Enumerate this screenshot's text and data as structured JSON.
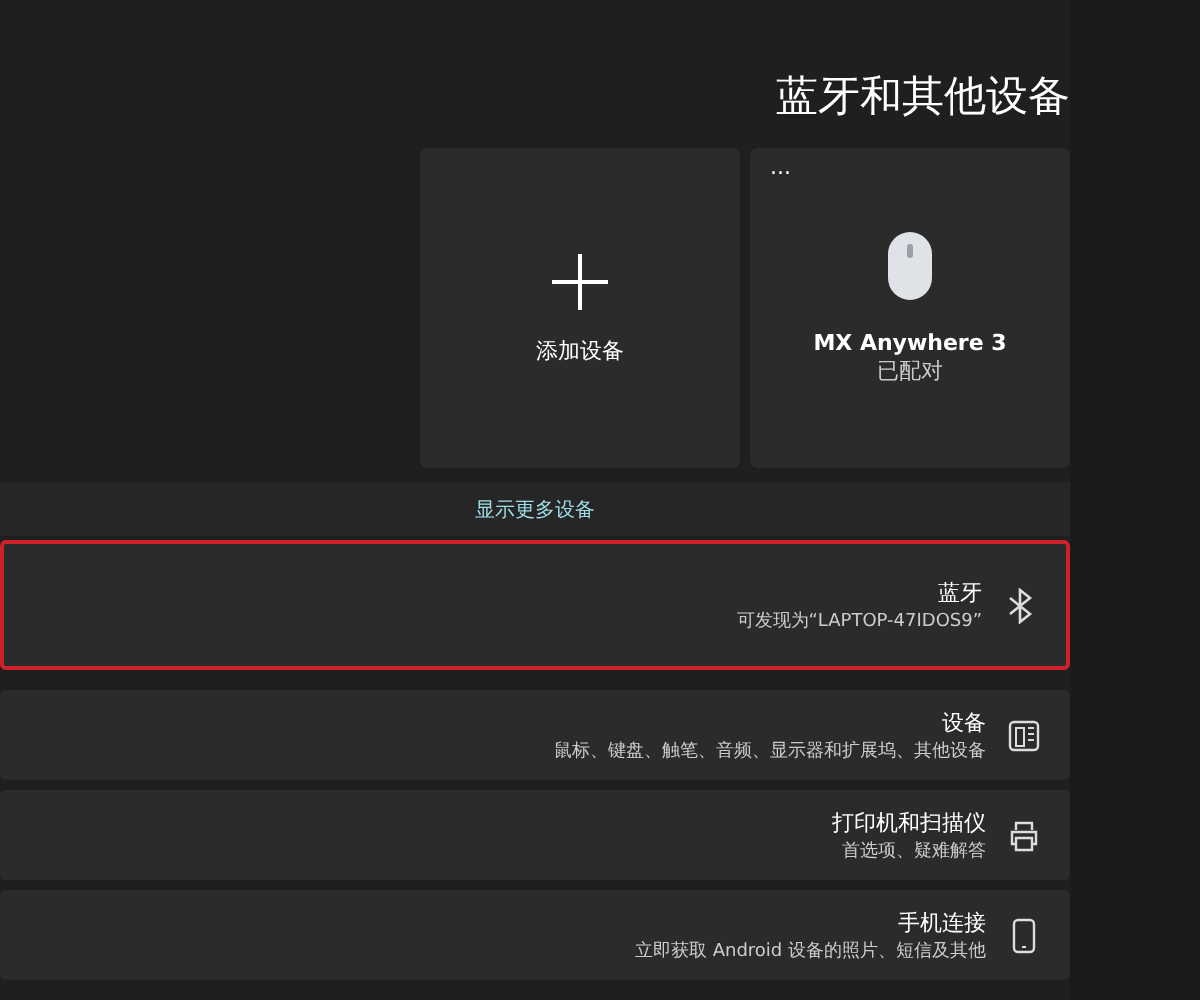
{
  "title": "蓝牙和其他设备",
  "cards": [
    {
      "kind": "add",
      "label": "添加设备"
    },
    {
      "kind": "device",
      "menu": "...",
      "name": "MX Anywhere 3",
      "status": "已配对"
    }
  ],
  "show_more": "显示更多设备",
  "rows": [
    {
      "kind": "bluetooth",
      "title": "蓝牙",
      "subtitle": "可发现为“LAPTOP-47IDOS9”",
      "highlighted": true
    },
    {
      "kind": "devices",
      "title": "设备",
      "subtitle": "鼠标、键盘、触笔、音频、显示器和扩展坞、其他设备",
      "highlighted": false
    },
    {
      "kind": "printer",
      "title": "打印机和扫描仪",
      "subtitle": "首选项、疑难解答",
      "highlighted": false
    },
    {
      "kind": "phone",
      "title": "手机连接",
      "subtitle": "立即获取 Android 设备的照片、短信及其他",
      "highlighted": false
    }
  ]
}
